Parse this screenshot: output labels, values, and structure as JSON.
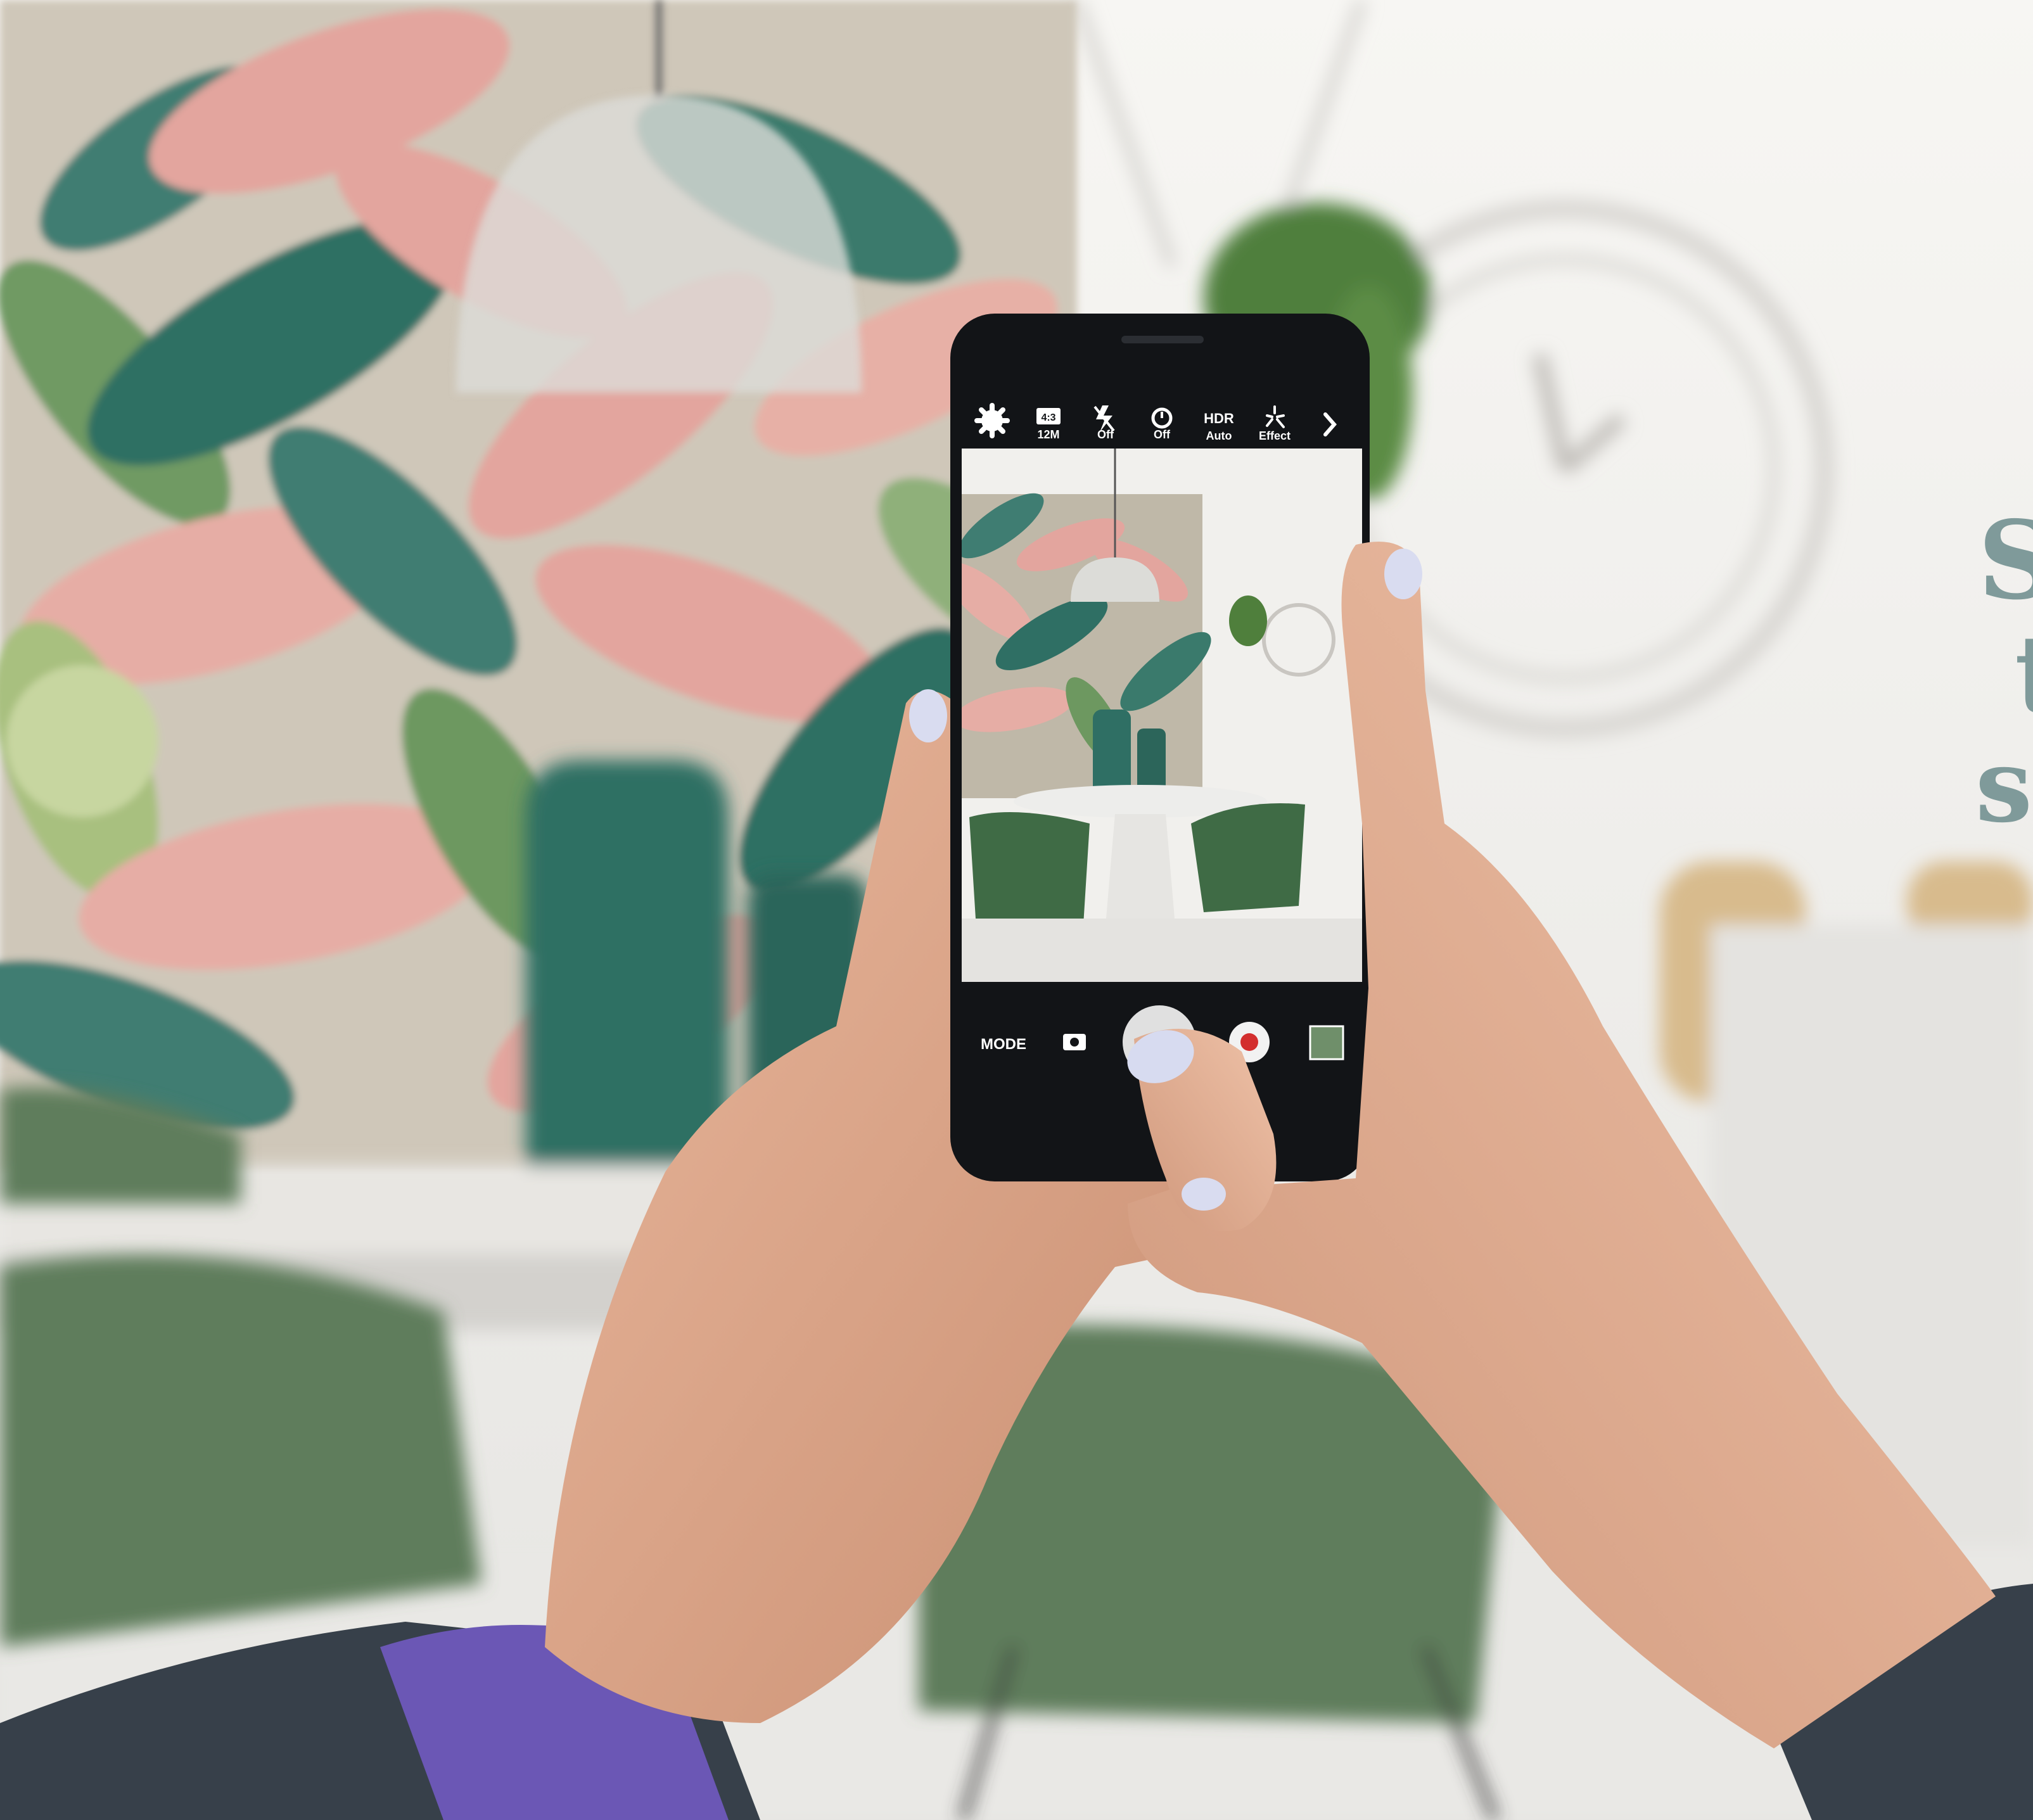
{
  "camera": {
    "top_bar": [
      {
        "icon": "settings-gear-icon",
        "label": ""
      },
      {
        "icon": "aspect-ratio-icon",
        "badge": "4:3",
        "label": "12M"
      },
      {
        "icon": "flash-off-icon",
        "label": "Off"
      },
      {
        "icon": "timer-icon",
        "label": "Off"
      },
      {
        "icon": "hdr-icon",
        "badge": "HDR",
        "label": "Auto"
      },
      {
        "icon": "effect-sparkle-icon",
        "label": "Effect"
      },
      {
        "icon": "chevron-right-icon",
        "label": ""
      }
    ],
    "bottom_bar": {
      "mode_label": "MODE",
      "switch_icon": "switch-camera-icon",
      "shutter_icon": "shutter-button-icon",
      "record_icon": "record-button-icon",
      "gallery_icon": "gallery-thumbnail-icon"
    }
  },
  "headline": {
    "line1": "S",
    "line2": "t",
    "line3": "s"
  },
  "colors": {
    "headline": "#7f9a9a",
    "wall_bg": "#f2f1ee",
    "phone_body": "#121417",
    "leaf_pink": "#e3a59e",
    "leaf_green": "#3f7d72",
    "chair_green": "#5f7d5c",
    "sleeve_purple": "#6b57b5"
  }
}
